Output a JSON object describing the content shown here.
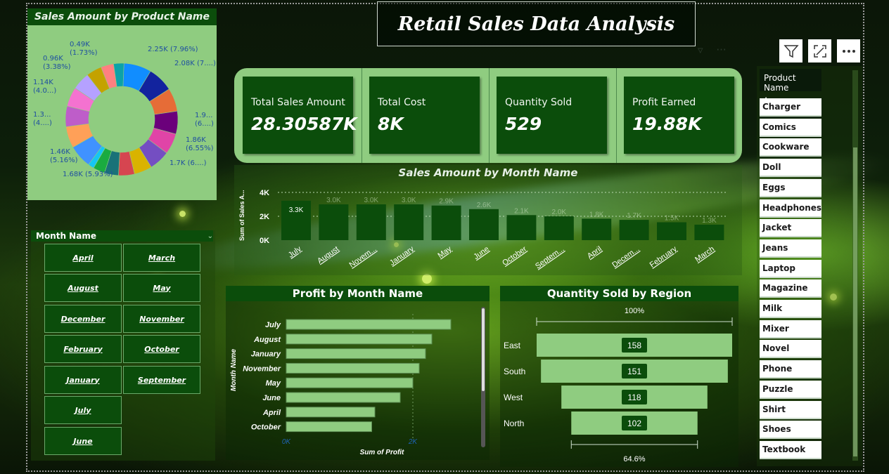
{
  "title": "Retail Sales Data Analysis",
  "pie_chart": {
    "title": "Sales Amount by Product Name",
    "labels": [
      {
        "line1": "2.25K (7.96%)",
        "line2": ""
      },
      {
        "line1": "2.08K (7....)",
        "line2": ""
      },
      {
        "line1": "1.9...",
        "line2": "(6....)"
      },
      {
        "line1": "1.86K",
        "line2": "(6.55%)"
      },
      {
        "line1": "1.7K (6....)",
        "line2": ""
      },
      {
        "line1": "1.68K (5.93%)",
        "line2": ""
      },
      {
        "line1": "1.46K",
        "line2": "(5.16%)"
      },
      {
        "line1": "1.3...",
        "line2": "(4....)"
      },
      {
        "line1": "1.14K",
        "line2": "(4.0...)"
      },
      {
        "line1": "0.96K",
        "line2": "(3.38%)"
      },
      {
        "line1": "0.49K",
        "line2": "(1.73%)"
      }
    ]
  },
  "chart_data": [
    {
      "type": "pie",
      "title": "Sales Amount by Product Name",
      "values": [
        2.25,
        2.08,
        1.9,
        1.86,
        1.7,
        1.68,
        1.46,
        1.3,
        1.14,
        0.96,
        0.49
      ],
      "unit": "K",
      "colors": [
        "#118dff",
        "#12239e",
        "#e66c37",
        "#6b007b",
        "#e044a7",
        "#744ec2",
        "#d9b300",
        "#d64550",
        "#197278",
        "#1aab40",
        "#15c6f4",
        "#4092ff",
        "#ffa058",
        "#be5dc9",
        "#f472d0",
        "#b5a1ff",
        "#c4a200",
        "#ff8080",
        "#0ca2a8",
        "#15e07e"
      ]
    },
    {
      "type": "bar",
      "title": "Sales Amount by Month Name",
      "ylabel": "Sum of Sales A...",
      "yticks": [
        "0K",
        "2K",
        "4K"
      ],
      "ylim": [
        0,
        4
      ],
      "categories": [
        "July",
        "August",
        "Novem...",
        "January",
        "May",
        "June",
        "October",
        "Septem...",
        "April",
        "Decem...",
        "February",
        "March"
      ],
      "values": [
        3.3,
        3.0,
        3.0,
        3.0,
        2.9,
        2.6,
        2.1,
        2.0,
        1.8,
        1.7,
        1.5,
        1.3
      ],
      "data_labels": [
        "3.3K",
        "3.0K",
        "3.0K",
        "3.0K",
        "2.9K",
        "2.6K",
        "2.1K",
        "2.0K",
        "1.8K",
        "1.7K",
        "1.5K",
        "1.3K"
      ],
      "bar_color": "#0b4d0b"
    },
    {
      "type": "bar",
      "orientation": "horizontal",
      "title": "Profit by Month Name",
      "xlabel": "Sum of Profit",
      "ylabel": "Month Name",
      "xticks": [
        "0K",
        "2K"
      ],
      "xlim": [
        0,
        3.5
      ],
      "categories": [
        "July",
        "August",
        "January",
        "November",
        "May",
        "June",
        "April",
        "October"
      ],
      "values": [
        2.6,
        2.3,
        2.2,
        2.1,
        2.0,
        1.8,
        1.4,
        1.35
      ],
      "bar_color": "#8fcc80"
    },
    {
      "type": "funnel",
      "title": "Quantity Sold by Region",
      "categories": [
        "East",
        "South",
        "West",
        "North"
      ],
      "values": [
        158,
        151,
        118,
        102
      ],
      "top_label": "100%",
      "bottom_label": "64.6%",
      "bar_color": "#8fcc80"
    }
  ],
  "month_slicer": {
    "header": "Month Name",
    "months": [
      "April",
      "March",
      "August",
      "May",
      "December",
      "November",
      "February",
      "October",
      "January",
      "September",
      "July",
      "June"
    ]
  },
  "kpis": [
    {
      "label": "Total Sales Amount",
      "value": "28.30587K"
    },
    {
      "label": "Total Cost",
      "value": "8K"
    },
    {
      "label": "Quantity Sold",
      "value": "529"
    },
    {
      "label": "Profit Earned",
      "value": "19.88K"
    }
  ],
  "product_slicer": {
    "header": "Product Name",
    "items": [
      "Charger",
      "Comics",
      "Cookware",
      "Doll",
      "Eggs",
      "Headphones",
      "Jacket",
      "Jeans",
      "Laptop",
      "Magazine",
      "Milk",
      "Mixer",
      "Novel",
      "Phone",
      "Puzzle",
      "Shirt",
      "Shoes",
      "Textbook"
    ]
  },
  "icons": {
    "filter": "filter-icon",
    "focus": "focus-mode-icon",
    "more": "more-options-icon"
  }
}
